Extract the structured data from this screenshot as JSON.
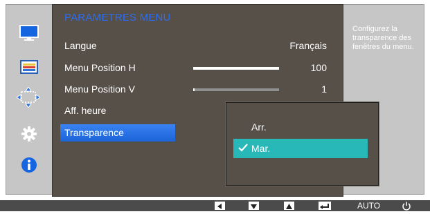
{
  "menu": {
    "title": "PARAMETRES MENU",
    "items": [
      {
        "label": "Langue",
        "value": "Français"
      },
      {
        "label": "Menu Position H",
        "value": "100",
        "level": 1.0
      },
      {
        "label": "Menu Position V",
        "value": "1",
        "level": 0.01
      },
      {
        "label": "Aff. heure"
      },
      {
        "label": "Transparence"
      }
    ]
  },
  "popup": {
    "options": [
      {
        "label": "Arr.",
        "selected": false
      },
      {
        "label": "Mar.",
        "selected": true
      }
    ]
  },
  "help_text": "Configurez la transparence des fenêtres du menu.",
  "sidebar_icons": [
    "picture-icon",
    "color-icon",
    "size-position-icon",
    "settings-gear-icon",
    "info-icon"
  ],
  "bottom_buttons": {
    "left": "left-arrow-icon",
    "down": "down-arrow-icon",
    "up": "up-arrow-icon",
    "enter": "enter-icon",
    "auto_label": "AUTO",
    "power": "power-icon"
  },
  "colors": {
    "title": "#2c6df0",
    "selected_row": "#2a73e8",
    "active_option": "#27b8b7",
    "panel": "#575049"
  }
}
